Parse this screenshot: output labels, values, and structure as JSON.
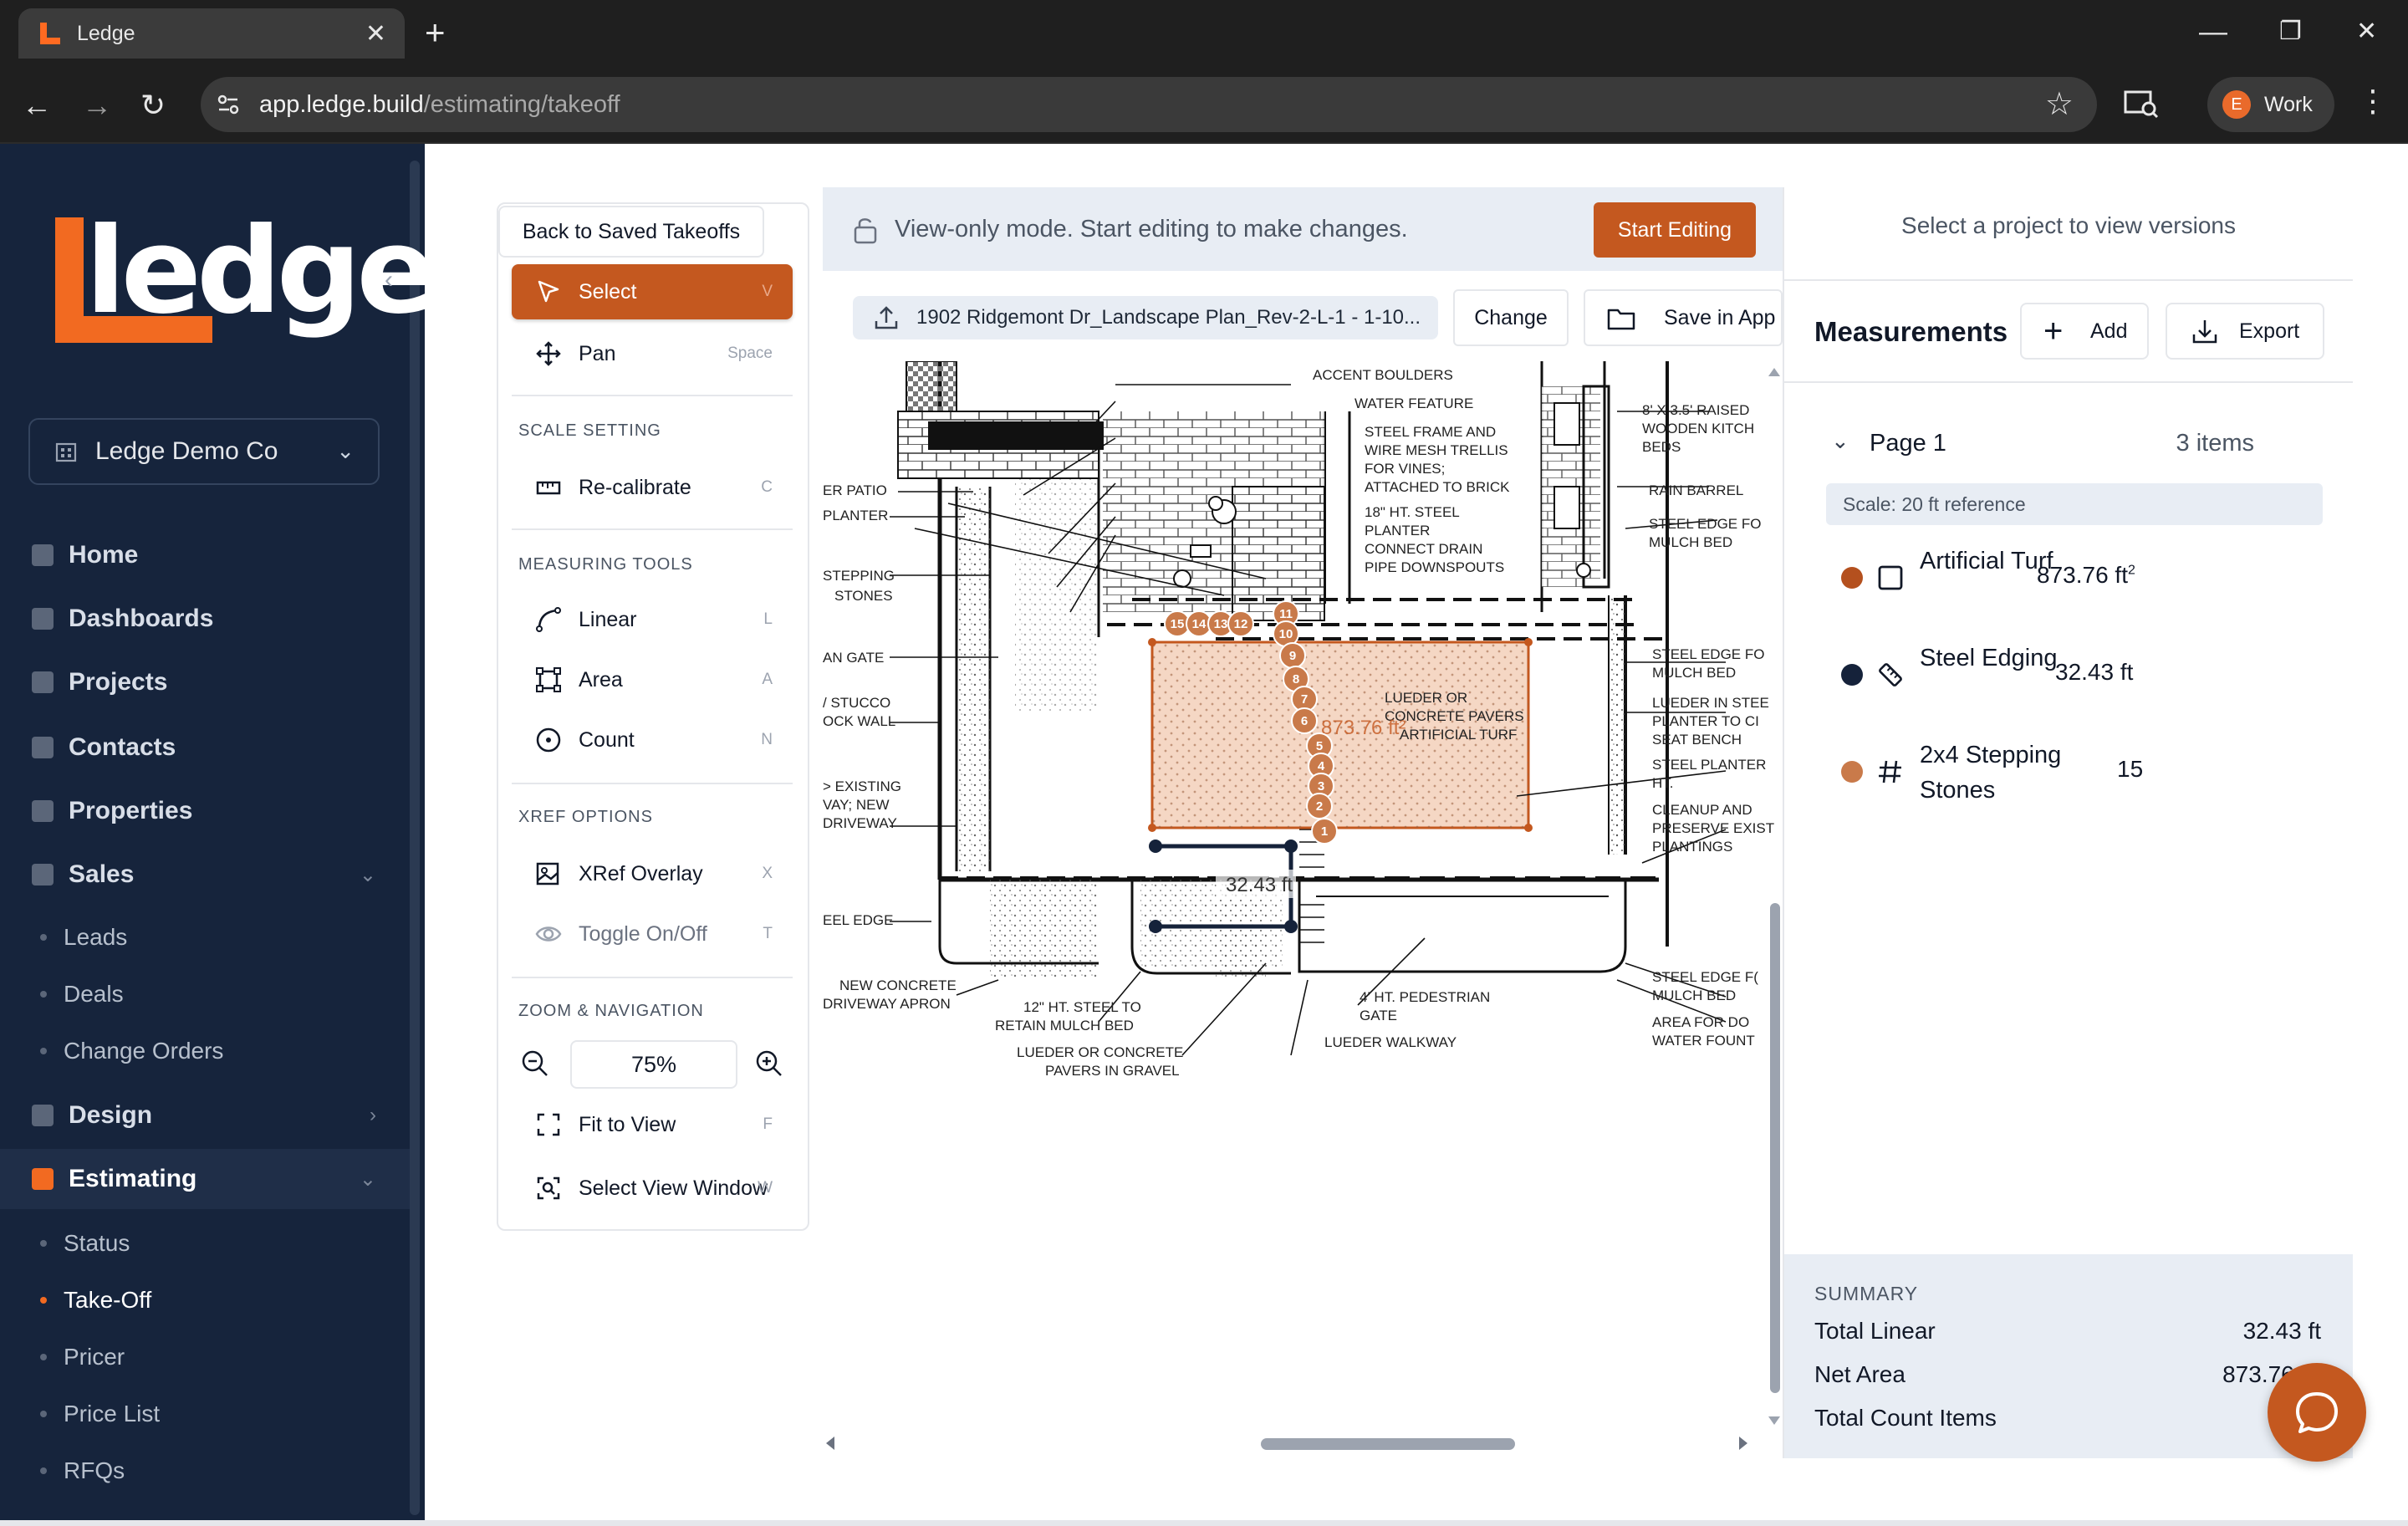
{
  "browser": {
    "tab_title": "Ledge",
    "tab_close": "✕",
    "new_tab": "+",
    "url_host": "app.ledge.build",
    "url_path": "/estimating/takeoff",
    "profile_initial": "E",
    "profile_label": "Work",
    "win_min": "—",
    "win_max": "❐",
    "win_close": "✕",
    "back": "←",
    "forward": "→",
    "reload": "↻",
    "star": "☆",
    "menu": "⋮"
  },
  "sidebar": {
    "brand": "ledge",
    "collapse": "‹",
    "org": "Ledge Demo Co",
    "nav": [
      {
        "label": "Home"
      },
      {
        "label": "Dashboards"
      },
      {
        "label": "Projects"
      },
      {
        "label": "Contacts"
      },
      {
        "label": "Properties"
      },
      {
        "label": "Sales",
        "caret": "⌄"
      },
      {
        "label": "Design",
        "caret": "›"
      },
      {
        "label": "Estimating",
        "caret": "⌄"
      }
    ],
    "sales_sub": [
      "Leads",
      "Deals",
      "Change Orders"
    ],
    "estimating_sub": [
      "Status",
      "Take-Off",
      "Pricer",
      "Price List",
      "RFQs"
    ]
  },
  "tools": {
    "back": "Back to Saved Takeoffs",
    "select": {
      "label": "Select",
      "key": "V"
    },
    "pan": {
      "label": "Pan",
      "key": "Space"
    },
    "scale_section": "SCALE SETTING",
    "recalibrate": {
      "label": "Re-calibrate",
      "key": "C"
    },
    "measuring_section": "MEASURING TOOLS",
    "linear": {
      "label": "Linear",
      "key": "L"
    },
    "area": {
      "label": "Area",
      "key": "A"
    },
    "count": {
      "label": "Count",
      "key": "N"
    },
    "xref_section": "XREF OPTIONS",
    "xref_overlay": {
      "label": "XRef Overlay",
      "key": "X"
    },
    "toggle": {
      "label": "Toggle On/Off",
      "key": "T"
    },
    "zoom_section": "ZOOM & NAVIGATION",
    "zoom_value": "75%",
    "fit": {
      "label": "Fit to View",
      "key": "F"
    },
    "select_window": {
      "label": "Select View Window",
      "key": "W"
    }
  },
  "center": {
    "view_only": "View-only mode. Start editing to make changes.",
    "start_editing": "Start Editing",
    "file_name": "1902 Ridgemont Dr_Landscape Plan_Rev-2-L-1 - 1-10...",
    "change": "Change",
    "save_in_app": "Save in App"
  },
  "plan": {
    "labels_left": [
      "ER PATIO",
      "PLANTER",
      "STEPPING",
      "STONES",
      "AN GATE",
      "/ STUCCO",
      "OCK WALL",
      "> EXISTING",
      "VAY; NEW",
      "DRIVEWAY",
      "EEL EDGE",
      "NEW CONCRETE",
      "DRIVEWAY APRON"
    ],
    "labels_top": [
      "ACCENT BOULDERS",
      "WATER FEATURE",
      "STEEL FRAME AND",
      "WIRE MESH TRELLIS",
      "FOR VINES;",
      "ATTACHED TO BRICK",
      "18\" HT. STEEL",
      "PLANTER",
      "CONNECT DRAIN",
      "PIPE DOWNSPOUTS"
    ],
    "labels_right": [
      "8' X 3.5' RAISED",
      "WOODEN KITCH",
      "BEDS",
      "RAIN BARREL",
      "STEEL EDGE FO",
      "MULCH BED",
      "STEEL EDGE FO",
      "MULCH BED",
      "LUEDER IN STEE",
      "PLANTER TO CI",
      "SEAT BENCH",
      "STEEL PLANTER",
      "HT.",
      "CLEANUP AND",
      "PRESERVE EXIST",
      "PLANTINGS",
      "STEEL EDGE F(",
      "MULCH BED",
      "AREA FOR DO",
      "WATER FOUNT"
    ],
    "labels_bottom": [
      "12\" HT. STEEL TO",
      "RETAIN MULCH BED",
      "LUEDER OR CONCRETE",
      "PAVERS IN GRAVEL",
      "4' HT. PEDESTRIAN",
      "GATE",
      "LUEDER WALKWAY"
    ],
    "labels_inner": [
      "LUEDER OR",
      "CONCRETE PAVERS",
      "ARTIFICIAL TURF"
    ],
    "area_label": "873.76 ft²",
    "linear_label": "32.43 ft",
    "count_markers": [
      "15",
      "14",
      "13",
      "12",
      "11",
      "10",
      "9",
      "8",
      "7",
      "6",
      "5",
      "4",
      "3",
      "2",
      "1"
    ]
  },
  "right": {
    "versions": "Select a project to view versions",
    "title": "Measurements",
    "add": "Add",
    "export": "Export",
    "page": "Page 1",
    "count": "3 items",
    "scale": "Scale: 20 ft reference",
    "items": [
      {
        "name": "Artificial Turf",
        "value": "873.76 ft",
        "sup": "2",
        "color": "#b4501e"
      },
      {
        "name": "Steel Edging",
        "value": "32.43 ft",
        "sup": "",
        "color": "#15223a"
      },
      {
        "name": "2x4 Stepping Stones",
        "value": "15",
        "sup": "",
        "color": "#c97a4a"
      }
    ],
    "summary": {
      "heading": "SUMMARY",
      "linear_label": "Total Linear",
      "linear_value": "32.43 ft",
      "area_label": "Net Area",
      "area_value": "873.76 ft",
      "area_sup": "2",
      "count_label": "Total Count Items"
    }
  },
  "colors": {
    "accent": "#c4581f",
    "brand_orange": "#f26a21",
    "sidebar_bg": "#16243c"
  }
}
